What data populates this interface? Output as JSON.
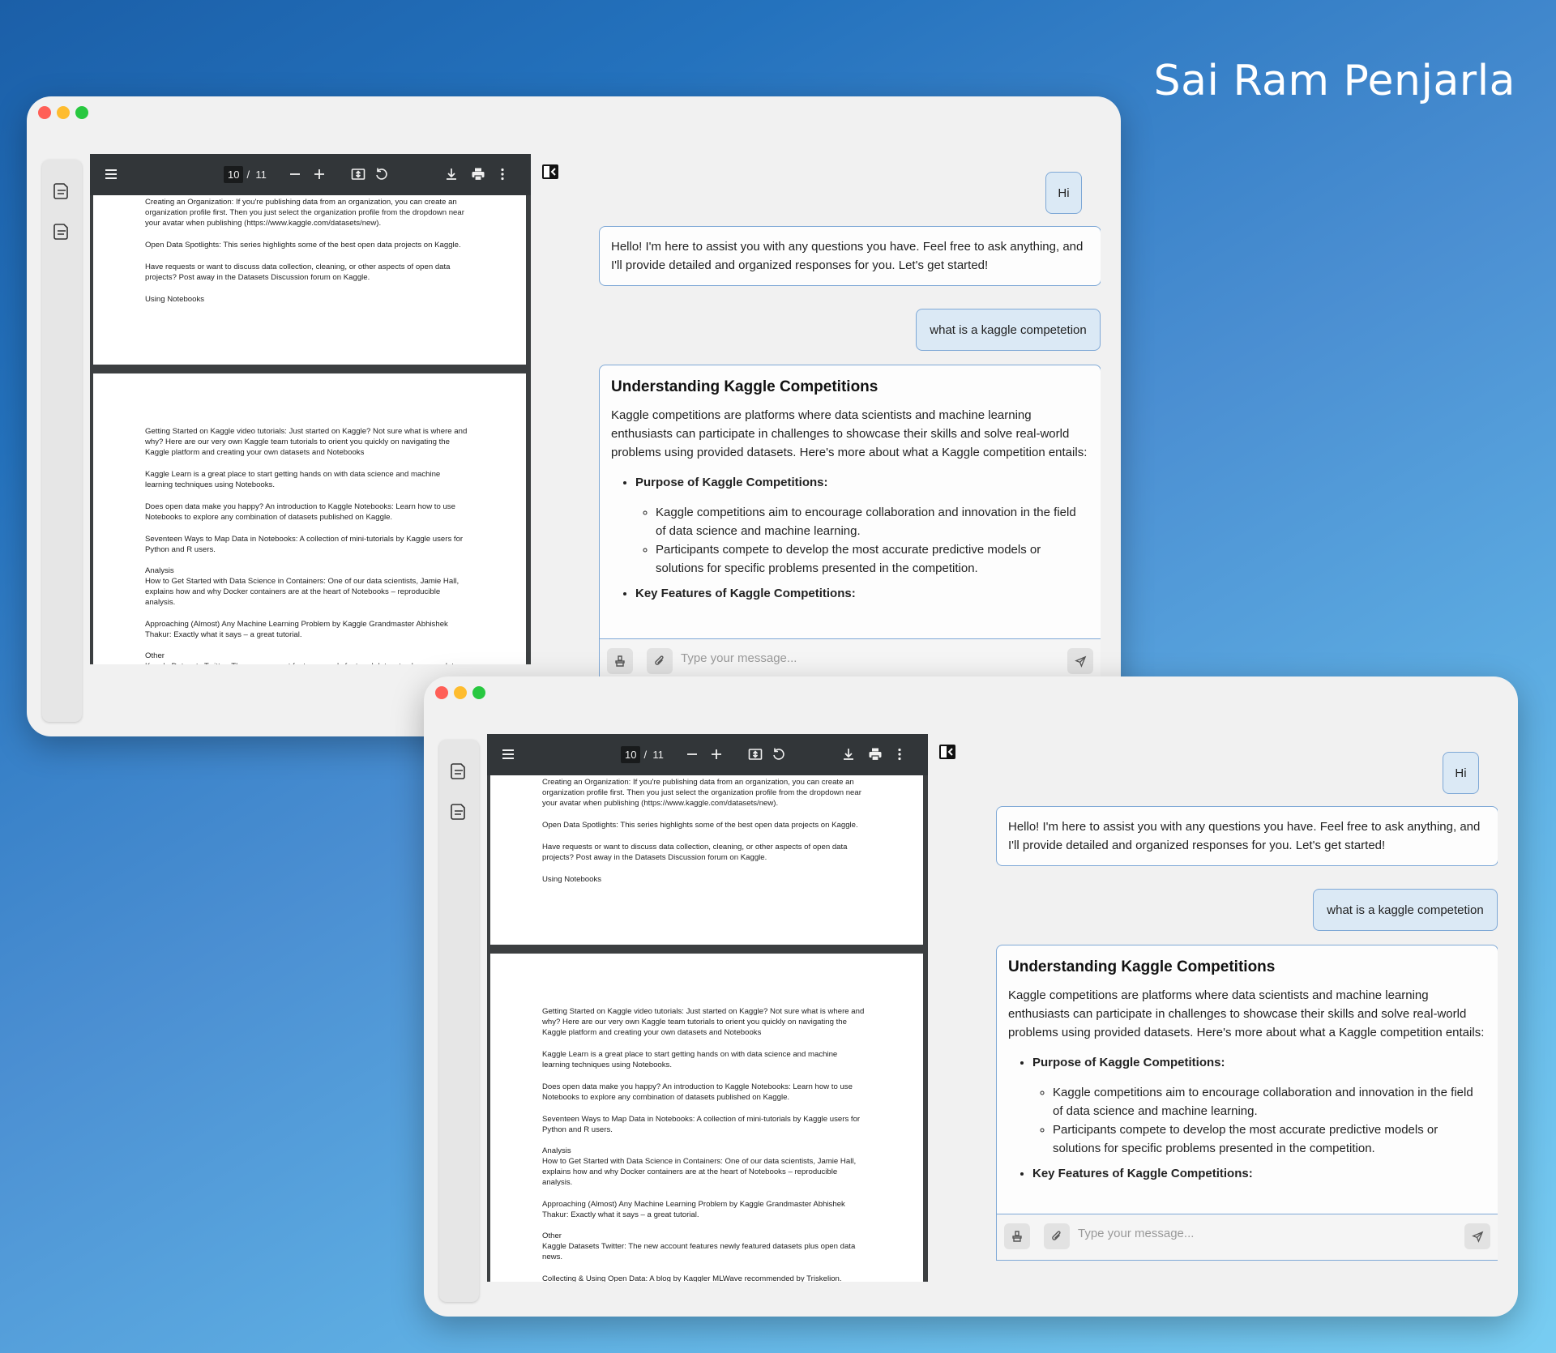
{
  "author": "Sai Ram Penjarla",
  "pdf_toolbar": {
    "current_page": "10",
    "separator": "/",
    "total_pages": "11",
    "zoom_out": "–",
    "zoom_in": "+"
  },
  "pdf_page_a": [
    "Creating an Organization: If you're publishing data from an organization, you can create an organization profile first. Then you just select the organization profile from the dropdown near your avatar when publishing (https://www.kaggle.com/datasets/new).",
    "Open Data Spotlights: This series highlights some of the best open data projects on Kaggle.",
    "Have requests or want to discuss data collection, cleaning, or other aspects of open data projects? Post away in the Datasets Discussion forum on Kaggle.",
    "Using Notebooks"
  ],
  "pdf_page_b": [
    "Getting Started on Kaggle video tutorials: Just started on Kaggle? Not sure what is where and why? Here are our very own Kaggle team tutorials to orient you quickly on navigating the Kaggle platform and creating your own datasets and Notebooks",
    "Kaggle Learn is a great place to start getting hands on with data science and machine learning techniques using Notebooks.",
    "Does open data make you happy? An introduction to Kaggle Notebooks: Learn how to use Notebooks to explore any combination of datasets published on Kaggle.",
    "Seventeen Ways to Map Data in Notebooks: A collection of mini-tutorials by Kaggle users for Python and R users.",
    "Analysis\nHow to Get Started with Data Science in Containers: One of our data scientists, Jamie Hall, explains how and why Docker containers are at the heart of Notebooks – reproducible analysis.",
    "Approaching (Almost) Any Machine Learning Problem by Kaggle Grandmaster Abhishek Thakur: Exactly what it says – a great tutorial.",
    "Other\nKaggle Datasets Twitter: The new account features newly featured datasets plus open data news.",
    "Collecting & Using Open Data: A blog by Kaggler MLWave recommended by Triskelion."
  ],
  "chat": {
    "msg1_user": "Hi",
    "msg2_bot": "Hello! I'm here to assist you with any questions you have. Feel free to ask anything, and I'll provide detailed and organized responses for you. Let's get started!",
    "msg3_user": "what is a kaggle competetion",
    "answer": {
      "title": "Understanding Kaggle Competitions",
      "intro": "Kaggle competitions are platforms where data scientists and machine learning enthusiasts can participate in challenges to showcase their skills and solve real-world problems using provided datasets. Here's more about what a Kaggle competition entails:",
      "section1": "Purpose of Kaggle Competitions:",
      "point1": "Kaggle competitions aim to encourage collaboration and innovation in the field of data science and machine learning.",
      "point2": "Participants compete to develop the most accurate predictive models or solutions for specific problems presented in the competition.",
      "section2": "Key Features of Kaggle Competitions:"
    },
    "input_placeholder": "Type your message..."
  }
}
